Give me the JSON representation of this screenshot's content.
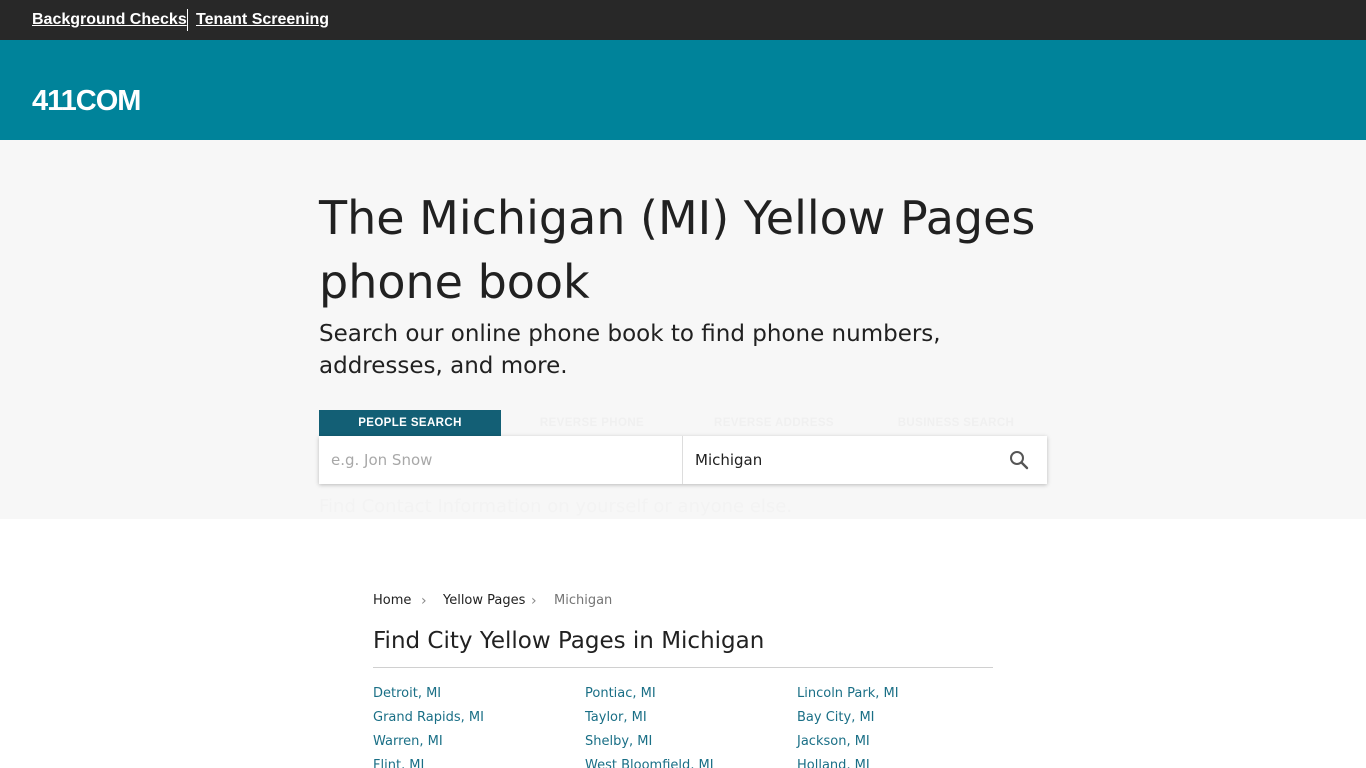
{
  "topbar": {
    "links": [
      "Background Checks",
      "Tenant Screening"
    ]
  },
  "header": {
    "logo": "411COM"
  },
  "hero": {
    "title": "The Michigan (MI) Yellow Pages phone book",
    "subtitle": "Search our online phone book to find phone numbers, addresses, and more.",
    "tabs": [
      "PEOPLE SEARCH",
      "REVERSE PHONE",
      "REVERSE ADDRESS",
      "BUSINESS SEARCH"
    ],
    "active_tab": "PEOPLE SEARCH",
    "search": {
      "name_placeholder": "e.g. Jon Snow",
      "name_value": "",
      "state_value": "Michigan"
    },
    "note": "Find Contact Information on yourself or anyone else."
  },
  "breadcrumb": [
    "Home",
    "Yellow Pages",
    "Michigan"
  ],
  "section": {
    "title": "Find City Yellow Pages in Michigan"
  },
  "cities": [
    [
      "Detroit, MI",
      "Grand Rapids, MI",
      "Warren, MI",
      "Flint, MI"
    ],
    [
      "Pontiac, MI",
      "Taylor, MI",
      "Shelby, MI",
      "West Bloomfield, MI"
    ],
    [
      "Lincoln Park, MI",
      "Bay City, MI",
      "Jackson, MI",
      "Holland, MI"
    ]
  ],
  "colors": {
    "topbar_bg": "#282828",
    "header_bg": "#00839a",
    "active_tab_bg": "#135f75",
    "link": "#1a6f86",
    "hero_bg": "#f7f7f7"
  },
  "icons": {
    "search": "search-icon",
    "breadcrumb_separator": "chevron-right-icon"
  }
}
